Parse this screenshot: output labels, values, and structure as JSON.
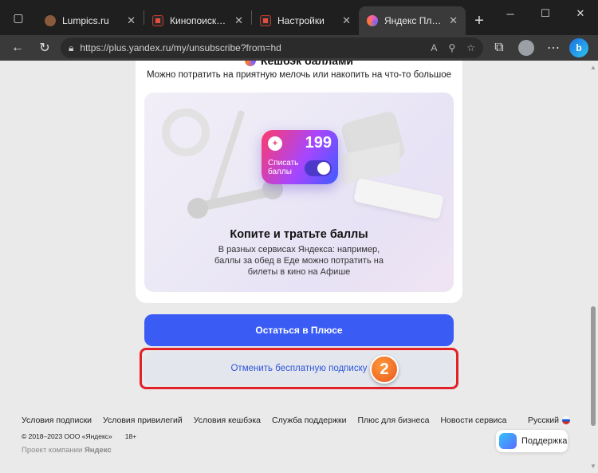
{
  "browser": {
    "tabs": [
      {
        "label": "Lumpics.ru",
        "favicon": "lumpics-favicon",
        "active": false
      },
      {
        "label": "Кинопоиск. Все фи",
        "favicon": "kinopoisk-favicon",
        "active": false
      },
      {
        "label": "Настройки",
        "favicon": "kinopoisk-favicon",
        "active": false
      },
      {
        "label": "Яндекс Плюс: упра",
        "favicon": "yandex-plus-favicon",
        "active": true
      }
    ],
    "url": "https://plus.yandex.ru/my/unsubscribe?from=hd"
  },
  "page": {
    "cashback_title": "Кешбэк баллами",
    "cashback_subtitle": "Можно потратить на приятную мелочь или накопить на что-то большое",
    "widget": {
      "value": "199",
      "label": "Списать баллы",
      "toggle_on": true
    },
    "promo_title": "Копите и тратьте баллы",
    "promo_text": "В разных сервисах Яндекса: например, баллы за обед в Еде можно потратить на билеты в кино на Афише",
    "stay_button": "Остаться в Плюсе",
    "cancel_button": "Отменить бесплатную подписку",
    "step_badge": "2",
    "accent_color": "#3a5cf5",
    "highlight_color": "#e2222b"
  },
  "footer": {
    "links": [
      "Условия подписки",
      "Условия привилегий",
      "Условия кешбэка",
      "Служба поддержки",
      "Плюс для бизнеса",
      "Новости сервиса"
    ],
    "language": "Русский",
    "copyright": "© 2018–2023 ООО «Яндекс»",
    "age": "18+",
    "project_prefix": "Проект компании",
    "project_company": "Яндекс",
    "support_button": "Поддержка"
  }
}
